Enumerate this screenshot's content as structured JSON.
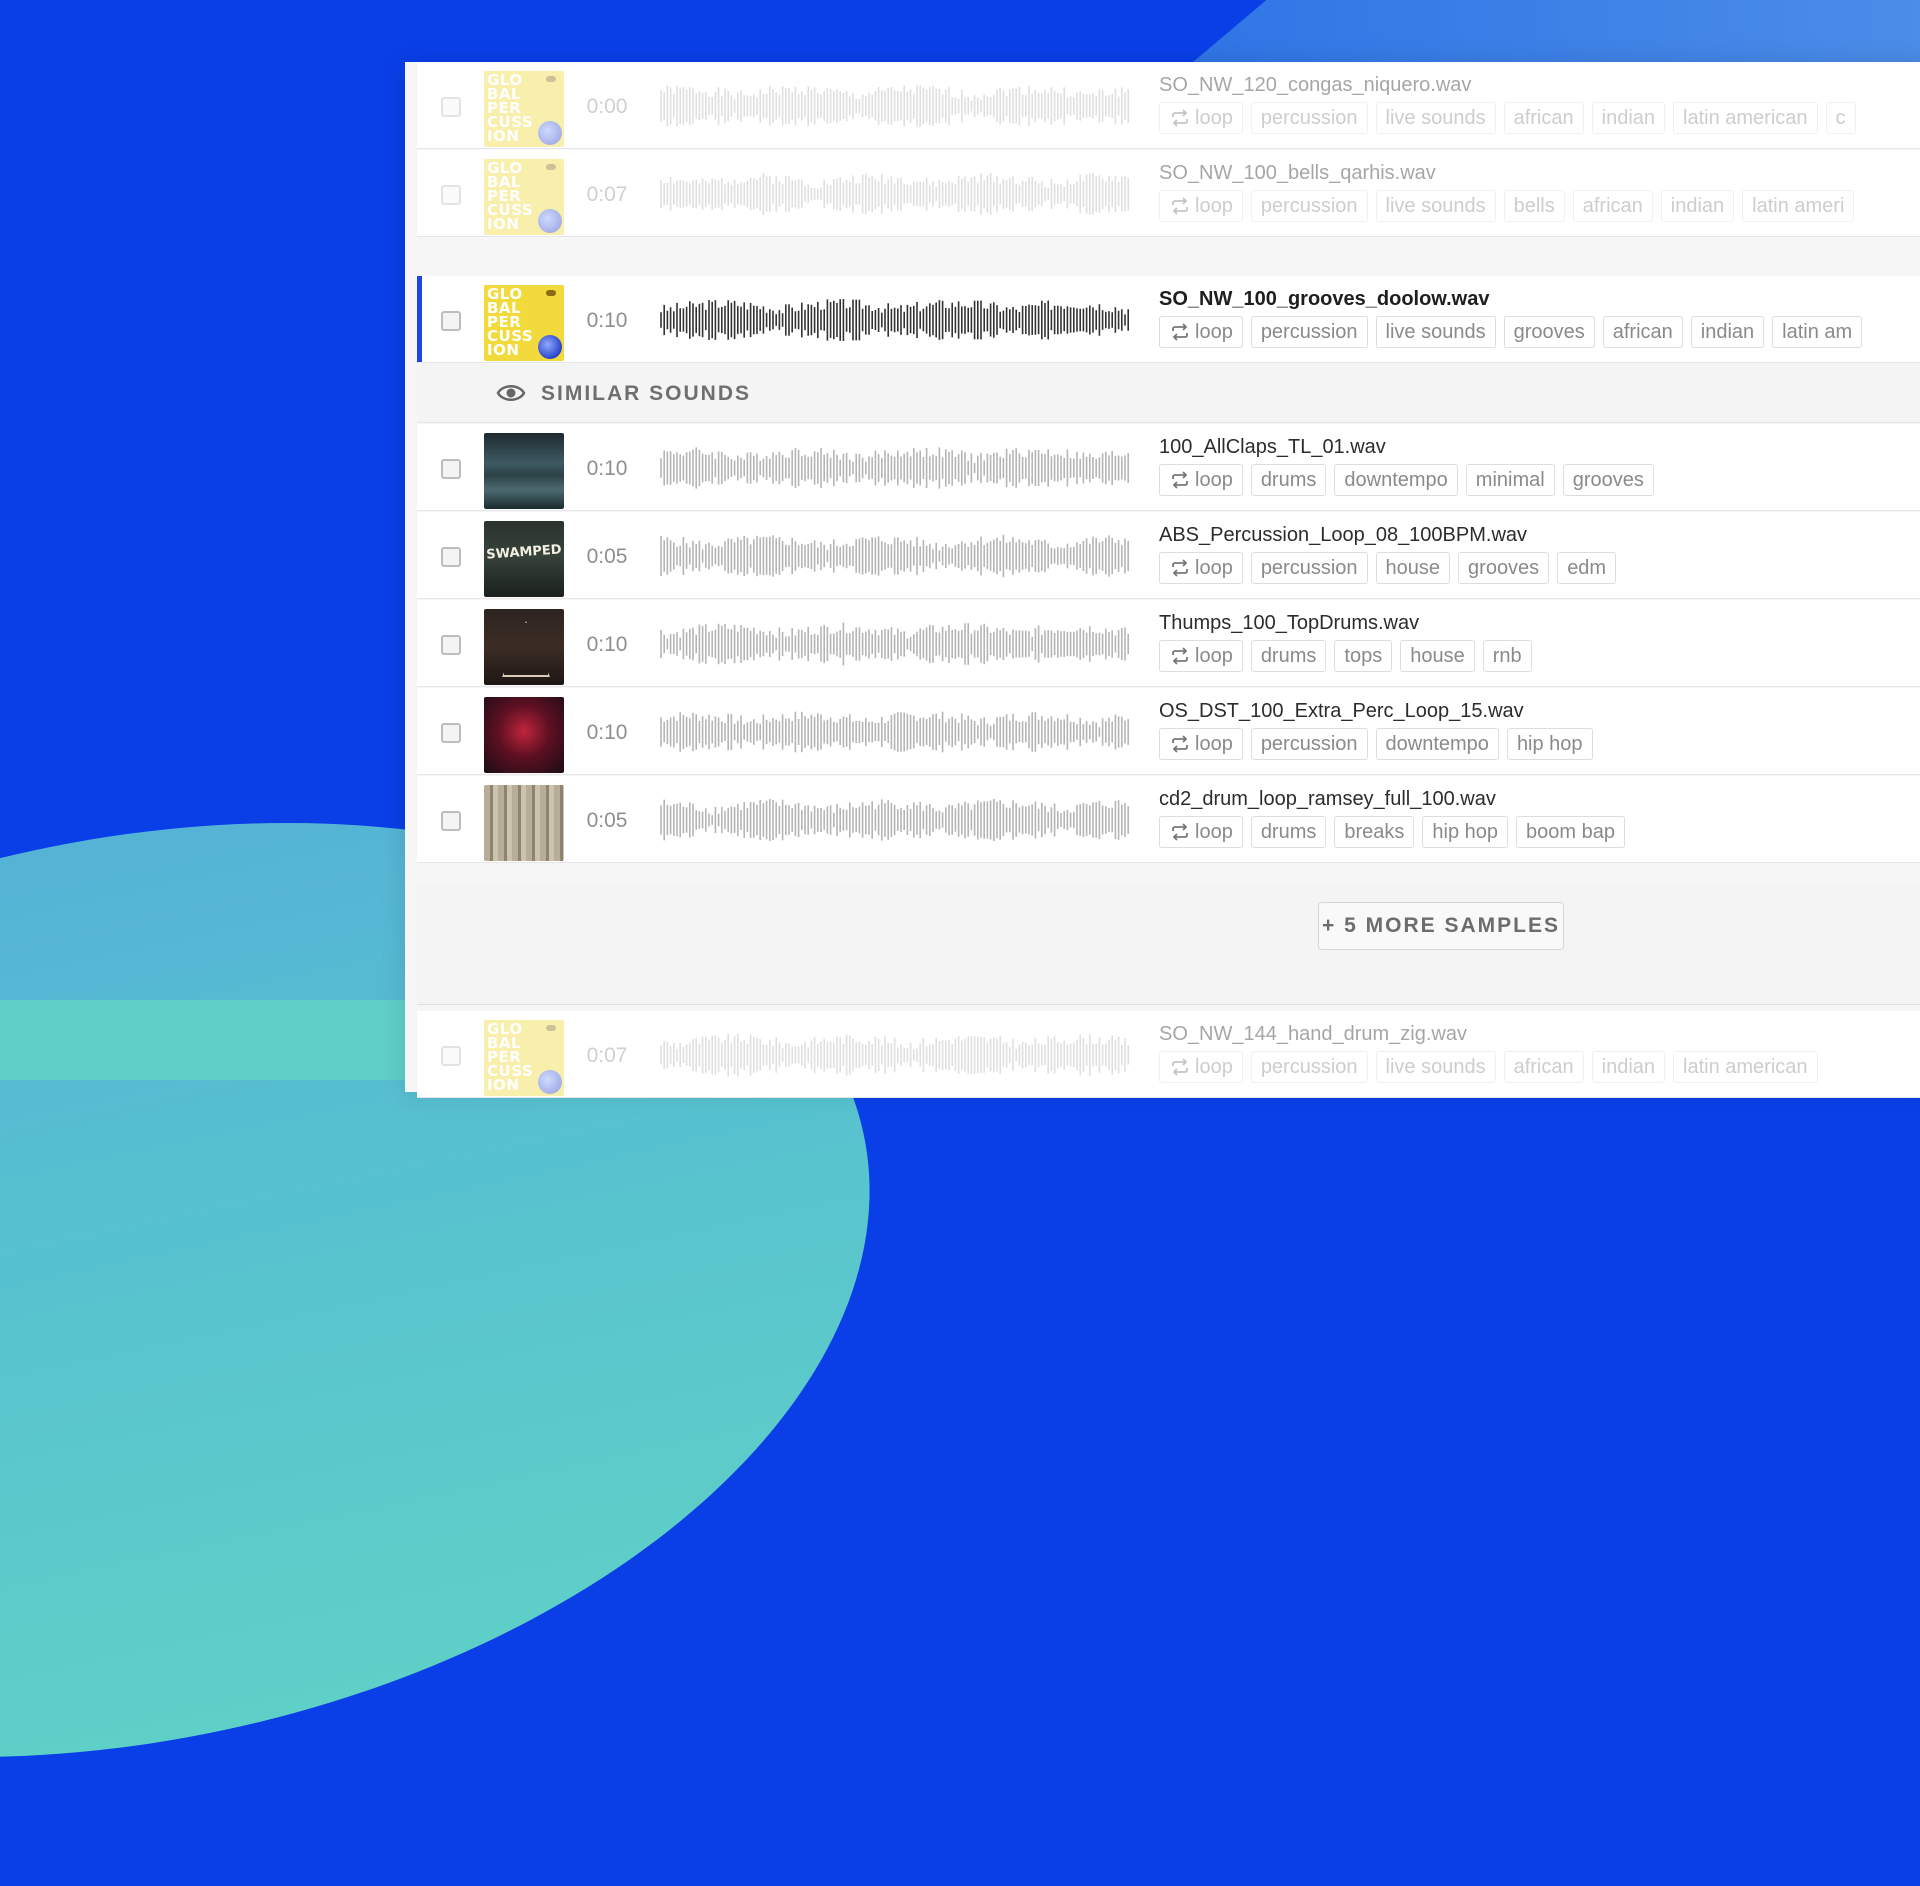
{
  "colors": {
    "background_blue": "#0a3fe8",
    "background_teal": "#5fcfc8",
    "active_accent": "#1e44e8",
    "tag_border": "#dddddd"
  },
  "rows_top": [
    {
      "state": "faded",
      "cover": "gp",
      "duration": "0:00",
      "filename": "SO_NW_120_congas_niquero.wav",
      "tags": [
        "loop",
        "percussion",
        "live sounds",
        "african",
        "indian",
        "latin american",
        "c"
      ]
    },
    {
      "state": "faded",
      "cover": "gp",
      "duration": "0:07",
      "filename": "SO_NW_100_bells_qarhis.wav",
      "tags": [
        "loop",
        "percussion",
        "live sounds",
        "bells",
        "african",
        "indian",
        "latin ameri"
      ]
    },
    {
      "state": "active",
      "cover": "gp",
      "duration": "0:10",
      "filename": "SO_NW_100_grooves_doolow.wav",
      "tags": [
        "loop",
        "percussion",
        "live sounds",
        "grooves",
        "african",
        "indian",
        "latin am"
      ]
    }
  ],
  "cover_gp_text": "GLO BAL PER CUSS ION",
  "similar": {
    "icon": "eye-icon",
    "label": "SIMILAR SOUNDS"
  },
  "similar_rows": [
    {
      "cover": "c1",
      "duration": "0:10",
      "filename": "100_AllClaps_TL_01.wav",
      "tags": [
        "loop",
        "drums",
        "downtempo",
        "minimal",
        "grooves"
      ]
    },
    {
      "cover": "c2",
      "cover_text": "SWAMPED",
      "duration": "0:05",
      "filename": "ABS_Percussion_Loop_08_100BPM.wav",
      "tags": [
        "loop",
        "percussion",
        "house",
        "grooves",
        "edm"
      ]
    },
    {
      "cover": "c3",
      "duration": "0:10",
      "filename": "Thumps_100_TopDrums.wav",
      "tags": [
        "loop",
        "drums",
        "tops",
        "house",
        "rnb"
      ]
    },
    {
      "cover": "c4",
      "duration": "0:10",
      "filename": "OS_DST_100_Extra_Perc_Loop_15.wav",
      "tags": [
        "loop",
        "percussion",
        "downtempo",
        "hip hop"
      ]
    },
    {
      "cover": "c5",
      "duration": "0:05",
      "filename": "cd2_drum_loop_ramsey_full_100.wav",
      "tags": [
        "loop",
        "drums",
        "breaks",
        "hip hop",
        "boom bap"
      ]
    }
  ],
  "more_button": "+ 5 MORE SAMPLES",
  "row_bottom": {
    "state": "faded",
    "cover": "gp",
    "duration": "0:07",
    "filename": "SO_NW_144_hand_drum_zig.wav",
    "tags": [
      "loop",
      "percussion",
      "live sounds",
      "african",
      "indian",
      "latin american"
    ]
  }
}
